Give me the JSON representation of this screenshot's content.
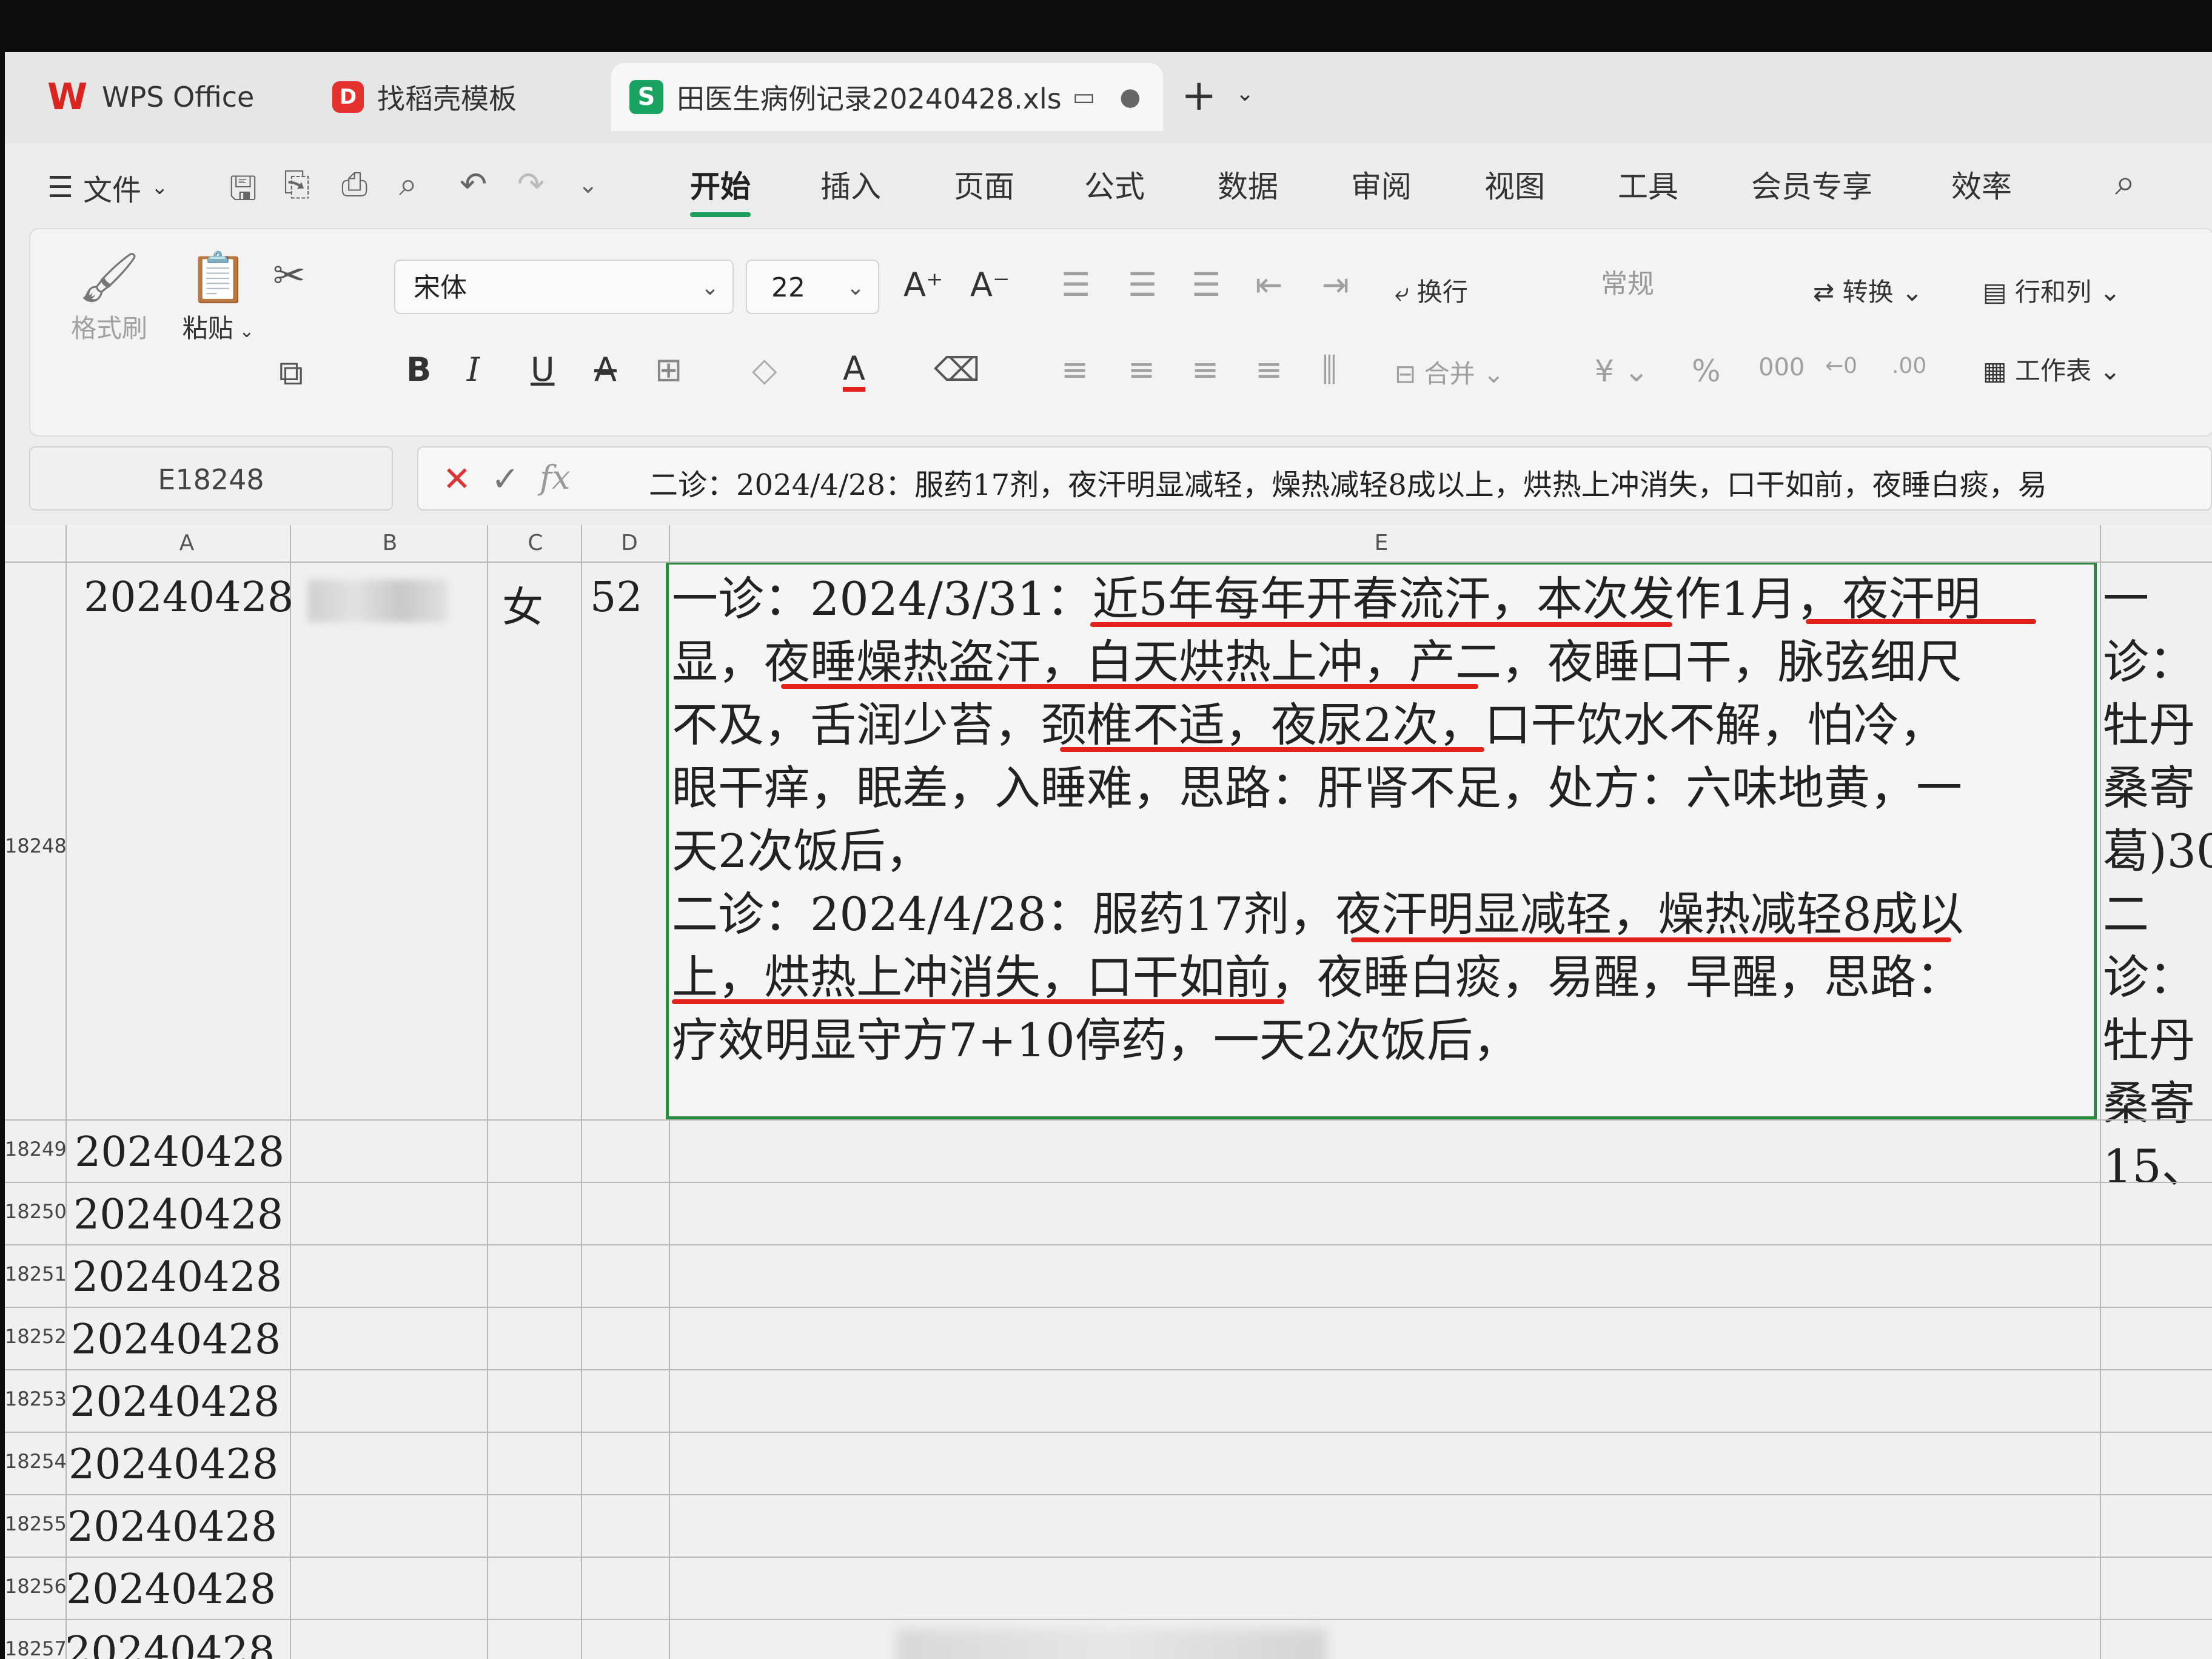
{
  "tabs": {
    "wps": "WPS Office",
    "template": "找稻壳模板",
    "file": "田医生病例记录20240428.xls"
  },
  "menu": {
    "file": "文件",
    "tabs": [
      "开始",
      "插入",
      "页面",
      "公式",
      "数据",
      "审阅",
      "视图",
      "工具",
      "会员专享",
      "效率"
    ]
  },
  "ribbon": {
    "format_painter": "格式刷",
    "paste": "粘贴",
    "font": "宋体",
    "font_size": "22",
    "wrap": "换行",
    "merge": "合并",
    "number_format": "常规",
    "convert": "转换",
    "row_col": "行和列",
    "worksheet": "工作表",
    "bold": "B",
    "italic": "I",
    "underline": "U",
    "font_color": "A"
  },
  "formula_bar": {
    "cell_ref": "E18248",
    "content": "二诊：2024/4/28：服药17剂，夜汗明显减轻，燥热减轻8成以上，烘热上冲消失，口干如前，夜睡白痰，易"
  },
  "grid": {
    "columns": [
      "A",
      "B",
      "C",
      "D",
      "E"
    ],
    "main_row": {
      "row_number": "18248",
      "date": "20240428",
      "sex": "女",
      "age": "52",
      "diagnosis_lines": [
        "一诊：2024/3/31：近5年每年开春流汗，本次发作1月，夜汗明",
        "显，夜睡燥热盗汗，白天烘热上冲，产二，夜睡口干，脉弦细尺",
        "不及，舌润少苔，颈椎不适，夜尿2次，口干饮水不解，怕冷，",
        "眼干痒，眠差，入睡难，思路：肝肾不足，处方：六味地黄，一",
        "天2次饭后，",
        "二诊：2024/4/28：服药17剂，夜汗明显减轻，燥热减轻8成以",
        "上，烘热上冲消失，口干如前，夜睡白痰，易醒，早醒，思路：",
        "疗效明显守方7+10停药，一天2次饭后，"
      ],
      "next_column_lines": [
        "一诊：",
        "牡丹",
        "桑寄",
        "葛)30",
        "二诊：",
        "牡丹",
        "桑寄",
        "15、"
      ]
    },
    "rows": [
      {
        "num": "18249",
        "date": "20240428"
      },
      {
        "num": "18250",
        "date": "20240428"
      },
      {
        "num": "18251",
        "date": "20240428"
      },
      {
        "num": "18252",
        "date": "20240428"
      },
      {
        "num": "18253",
        "date": "20240428"
      },
      {
        "num": "18254",
        "date": "20240428"
      },
      {
        "num": "18255",
        "date": "20240428"
      },
      {
        "num": "18256",
        "date": "20240428"
      },
      {
        "num": "18257",
        "date": "20240428"
      }
    ]
  },
  "colors": {
    "accent_green": "#1a9c5a",
    "selection_border": "#2a8a3e",
    "underline_red": "#e3231b"
  }
}
